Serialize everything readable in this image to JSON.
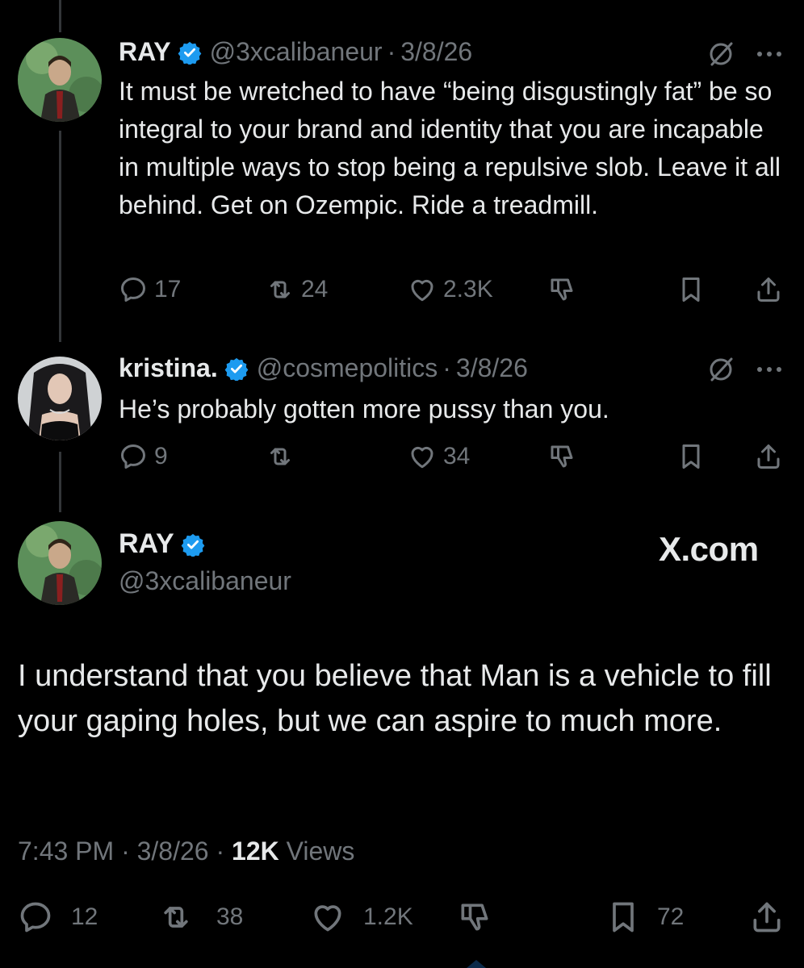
{
  "tweets": [
    {
      "name": "RAY",
      "handle": "@3xcalibaneur",
      "separator": "·",
      "date": "3/8/26",
      "text": "It must be wretched to have “being disgustingly fat” be so integral to your brand and identity that you are incapable in multiple ways to stop being a repulsive slob. Leave it all behind. Get on Ozempic. Ride a treadmill.",
      "replies": "17",
      "reposts": "24",
      "likes": "2.3K"
    },
    {
      "name": "kristina.",
      "handle": "@cosmepolitics",
      "separator": "·",
      "date": "3/8/26",
      "text": "He’s probably gotten more pussy than you.",
      "replies": "9",
      "reposts": "",
      "likes": "34"
    }
  ],
  "main_tweet": {
    "name": "RAY",
    "handle": "@3xcalibaneur",
    "watermark": "X.com",
    "text": "I understand that you believe that Man is a vehicle to fill your gaping holes, but we can aspire to much more.",
    "time": "7:43 PM",
    "separator": "·",
    "date": "3/8/26",
    "views_count": "12K",
    "views_label": "Views",
    "replies": "12",
    "reposts": "38",
    "likes": "1.2K",
    "bookmarks": "72"
  },
  "colors": {
    "background": "#000000",
    "text": "#e7e9ea",
    "muted": "#71767b",
    "verified": "#1d9bf0",
    "thread_line": "#333639"
  },
  "icons": [
    "verified-badge-icon",
    "grok-icon",
    "more-icon",
    "reply-icon",
    "repost-icon",
    "like-icon",
    "dislike-icon",
    "bookmark-icon",
    "share-icon"
  ]
}
